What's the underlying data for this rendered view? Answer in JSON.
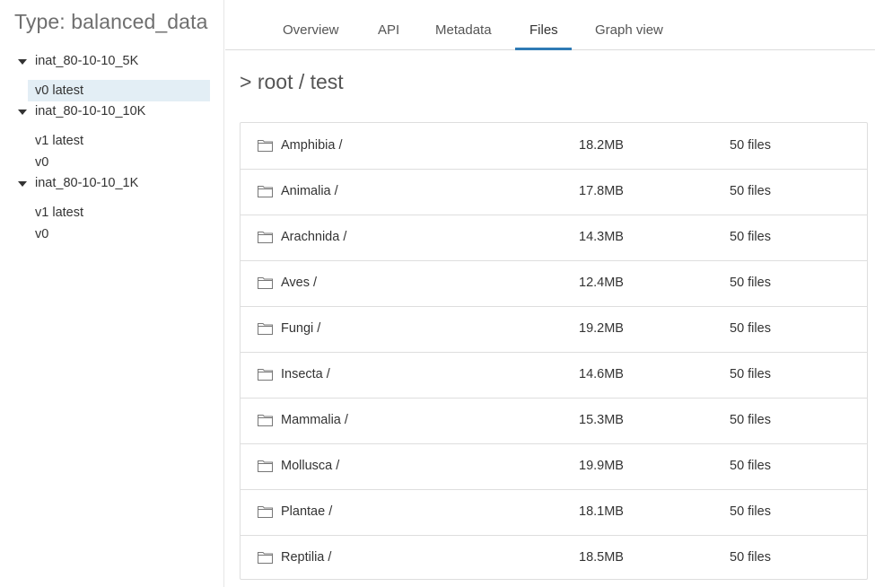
{
  "sidebar": {
    "title": "Type: balanced_data",
    "groups": [
      {
        "label": "inat_80-10-10_5K",
        "versions": [
          "v0 latest"
        ]
      },
      {
        "label": "inat_80-10-10_10K",
        "versions": [
          "v1 latest",
          "v0"
        ]
      },
      {
        "label": "inat_80-10-10_1K",
        "versions": [
          "v1 latest",
          "v0"
        ]
      }
    ],
    "selected_version": "v0 latest"
  },
  "tabs": {
    "items": [
      "Overview",
      "API",
      "Metadata",
      "Files",
      "Graph view"
    ],
    "active": "Files"
  },
  "breadcrumb": "> root / test",
  "files": {
    "rows": [
      {
        "name": "Amphibia /",
        "size": "18.2MB",
        "count": "50 files"
      },
      {
        "name": "Animalia /",
        "size": "17.8MB",
        "count": "50 files"
      },
      {
        "name": "Arachnida /",
        "size": "14.3MB",
        "count": "50 files"
      },
      {
        "name": "Aves /",
        "size": "12.4MB",
        "count": "50 files"
      },
      {
        "name": "Fungi /",
        "size": "19.2MB",
        "count": "50 files"
      },
      {
        "name": "Insecta /",
        "size": "14.6MB",
        "count": "50 files"
      },
      {
        "name": "Mammalia /",
        "size": "15.3MB",
        "count": "50 files"
      },
      {
        "name": "Mollusca /",
        "size": "19.9MB",
        "count": "50 files"
      },
      {
        "name": "Plantae /",
        "size": "18.1MB",
        "count": "50 files"
      },
      {
        "name": "Reptilia /",
        "size": "18.5MB",
        "count": "50 files"
      }
    ],
    "row_icon": "folder-icon"
  },
  "colors": {
    "accent": "#2f7bb5",
    "selected_bg": "#e3eef5"
  }
}
